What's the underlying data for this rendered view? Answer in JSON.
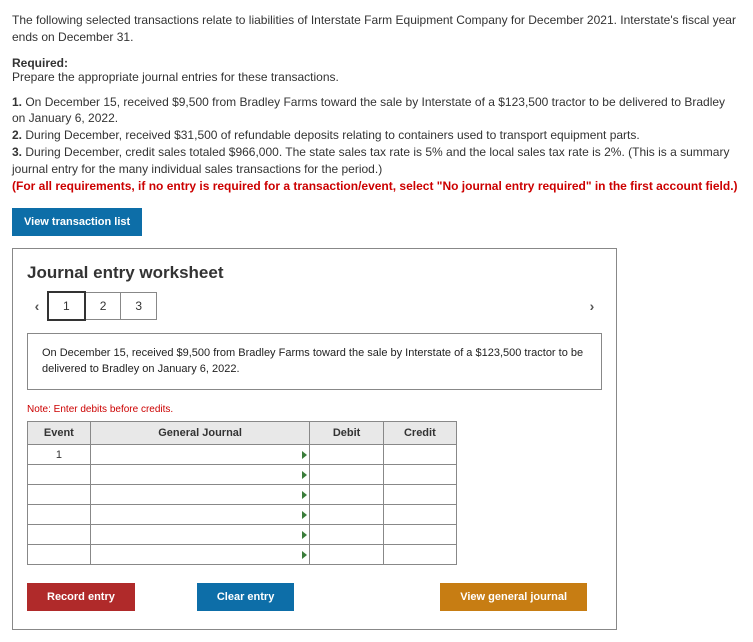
{
  "intro": "The following selected transactions relate to liabilities of Interstate Farm Equipment Company for December 2021. Interstate's fiscal year ends on December 31.",
  "required_header": "Required:",
  "required_text": "Prepare the appropriate journal entries for these transactions.",
  "items": [
    {
      "num": "1.",
      "text": " On December 15, received $9,500 from Bradley Farms toward the sale by Interstate of a $123,500 tractor to be delivered to Bradley on January 6, 2022."
    },
    {
      "num": "2.",
      "text": " During December, received $31,500 of refundable deposits relating to containers used to transport equipment parts."
    },
    {
      "num": "3.",
      "text": " During December, credit sales totaled $966,000. The state sales tax rate is 5% and the local sales tax rate is 2%. (This is a summary journal entry for the many individual sales transactions for the period.)"
    }
  ],
  "red_note": "(For all requirements, if no entry is required for a transaction/event, select \"No journal entry required\" in the first account field.)",
  "view_transaction_list": "View transaction list",
  "worksheet": {
    "title": "Journal entry worksheet",
    "tabs": [
      "1",
      "2",
      "3"
    ],
    "active_tab": "1",
    "description": "On December 15, received $9,500 from Bradley Farms toward the sale by Interstate of a $123,500 tractor to be delivered to Bradley on January 6, 2022.",
    "note": "Note: Enter debits before credits.",
    "headers": {
      "event": "Event",
      "gj": "General Journal",
      "debit": "Debit",
      "credit": "Credit"
    },
    "first_event": "1",
    "buttons": {
      "record": "Record entry",
      "clear": "Clear entry",
      "viewgj": "View general journal"
    }
  }
}
